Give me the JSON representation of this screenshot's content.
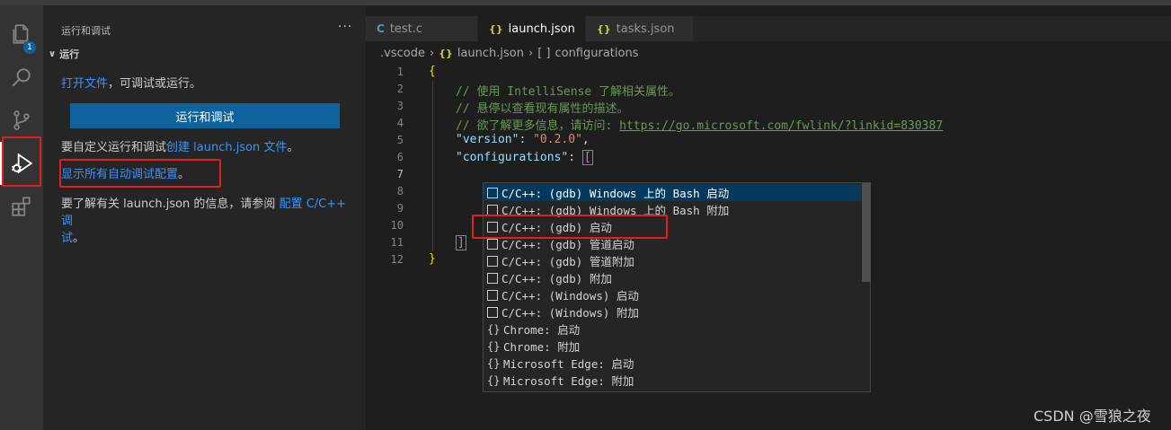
{
  "activity_bar": {
    "explorer_badge": "1",
    "items": [
      "files-icon",
      "search-icon",
      "source-control-icon",
      "run-debug-icon",
      "extensions-icon"
    ]
  },
  "sidebar": {
    "title": "运行和调试",
    "more": "···",
    "section": "运行",
    "line1_link": "打开文件",
    "line1_rest": "，可调试或运行。",
    "run_button": "运行和调试",
    "customize_prefix": "要自定义运行和调试",
    "customize_link": "创建 launch.json 文件",
    "customize_suffix": "。",
    "show_all_link": "显示所有自动调试配置",
    "show_all_suffix": "。",
    "info_prefix": "要了解有关 launch.json 的信息，请参阅",
    "info_link_1": "配置 C/C++ 调",
    "info_link_2": "试",
    "info_suffix": "。"
  },
  "tabs": [
    {
      "label": "test.c",
      "icon": "C"
    },
    {
      "label": "launch.json",
      "icon": "{}",
      "dirty": true
    },
    {
      "label": "tasks.json",
      "icon": "{}"
    }
  ],
  "breadcrumb": {
    "folder": ".vscode",
    "file": "launch.json",
    "symbol": "configurations",
    "symbol_icon": "[ ]",
    "file_icon": "{}"
  },
  "code": {
    "line_numbers": [
      "1",
      "2",
      "3",
      "4",
      "5",
      "6",
      "7",
      "8",
      "9",
      "10",
      "11",
      "12"
    ],
    "l1": "{",
    "l2": "// 使用 IntelliSense 了解相关属性。",
    "l3": "// 悬停以查看现有属性的描述。",
    "l4_text": "// 欲了解更多信息，请访问: ",
    "l4_url": "https://go.microsoft.com/fwlink/?linkid=830387",
    "l5_key": "\"version\"",
    "l5_val": "\"0.2.0\"",
    "l6_key": "\"configurations\"",
    "l6_open": "[",
    "l11": "]",
    "l12": "}"
  },
  "suggestions": [
    {
      "prefix": "C/C++: (gdb) Windows 上的 Bash 启动",
      "icon": "box"
    },
    {
      "prefix": "C/C++: (gdb) Windows 上的 Bash 附加",
      "icon": "box"
    },
    {
      "prefix": "C/C++: (gdb) 启动",
      "icon": "box"
    },
    {
      "prefix": "C/C++: (gdb) 管道启动",
      "icon": "box"
    },
    {
      "prefix": "C/C++: (gdb) 管道附加",
      "icon": "box"
    },
    {
      "prefix": "C/C++: (gdb) 附加",
      "icon": "box"
    },
    {
      "prefix": "C/C++: (Windows) 启动",
      "icon": "box"
    },
    {
      "prefix": "C/C++: (Windows) 附加",
      "icon": "box"
    },
    {
      "prefix": "Chrome: 启动",
      "icon": "braces"
    },
    {
      "prefix": "Chrome: 附加",
      "icon": "braces"
    },
    {
      "prefix": "Microsoft Edge: 启动",
      "icon": "braces"
    },
    {
      "prefix": "Microsoft Edge: 附加",
      "icon": "braces"
    }
  ],
  "watermark": "CSDN @雪狼之夜",
  "colors": {
    "accent": "#0e639c",
    "highlight_box": "#e02020",
    "selected_row": "#04395e"
  }
}
